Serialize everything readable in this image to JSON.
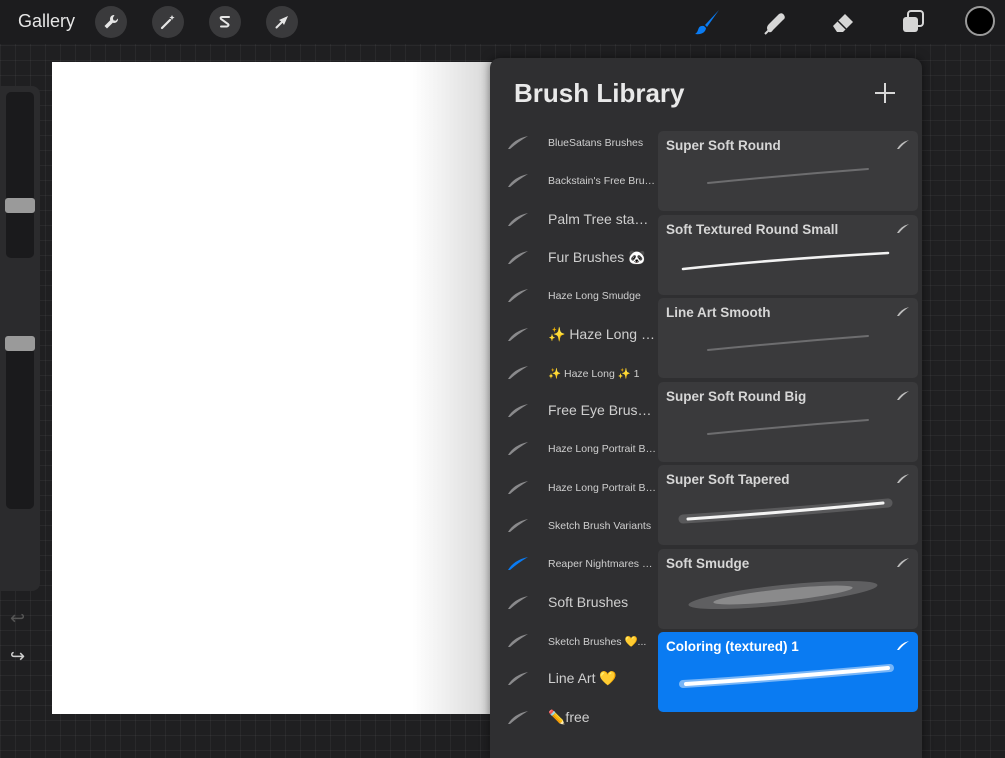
{
  "topbar": {
    "gallery_label": "Gallery",
    "left_tools": [
      "wrench-icon",
      "magic-wand-icon",
      "selection-s-icon",
      "transform-arrow-icon"
    ],
    "right_tools": [
      "brush-icon",
      "smudge-icon",
      "eraser-icon",
      "layers-icon"
    ],
    "active_tool": "brush-icon",
    "accent_color": "#0a7bf2",
    "current_color": "#000000"
  },
  "sidebar": {
    "size_level": 0.3,
    "opacity_level": 0.05,
    "undo_icon": "undo-icon",
    "redo_icon": "redo-icon"
  },
  "brush_library": {
    "title": "Brush Library",
    "add_icon": "plus-icon",
    "sets": [
      {
        "label": "BlueSatans Brushes",
        "size": "small",
        "active": false
      },
      {
        "label": "Backstain's Free Brus...",
        "size": "small",
        "active": false
      },
      {
        "label": "Palm Tree stamps",
        "size": "big",
        "active": false
      },
      {
        "label": "Fur Brushes 🐼",
        "size": "big",
        "active": false
      },
      {
        "label": "Haze Long Smudge",
        "size": "small",
        "active": false
      },
      {
        "label": "✨ Haze Long ✨",
        "size": "big",
        "active": false
      },
      {
        "label": "✨ Haze Long ✨  1",
        "size": "small",
        "active": false
      },
      {
        "label": "Free Eye Brushes",
        "size": "big",
        "active": false
      },
      {
        "label": "Haze Long Portrait Br...",
        "size": "small",
        "active": false
      },
      {
        "label": "Haze Long Portrait Br...",
        "size": "small",
        "active": false
      },
      {
        "label": "Sketch Brush Variants",
        "size": "small",
        "active": false
      },
      {
        "label": "Reaper Nightmares B...",
        "size": "small",
        "active": true
      },
      {
        "label": "Soft Brushes",
        "size": "big",
        "active": false
      },
      {
        "label": "Sketch Brushes 💛...",
        "size": "small",
        "active": false
      },
      {
        "label": "Line Art 💛",
        "size": "big",
        "active": false
      },
      {
        "label": "✏️free",
        "size": "big",
        "active": false
      }
    ],
    "brushes": [
      {
        "name": "Super Soft Round",
        "stroke": "faint",
        "selected": false
      },
      {
        "name": "Soft Textured Round Small",
        "stroke": "crisp",
        "selected": false
      },
      {
        "name": "Line Art Smooth",
        "stroke": "faint",
        "selected": false
      },
      {
        "name": "Super Soft Round Big",
        "stroke": "faint",
        "selected": false
      },
      {
        "name": "Super Soft Tapered",
        "stroke": "glow",
        "selected": false
      },
      {
        "name": "Soft Smudge",
        "stroke": "smudge",
        "selected": false
      },
      {
        "name": "Coloring (textured) 1",
        "stroke": "textured",
        "selected": true
      }
    ]
  }
}
